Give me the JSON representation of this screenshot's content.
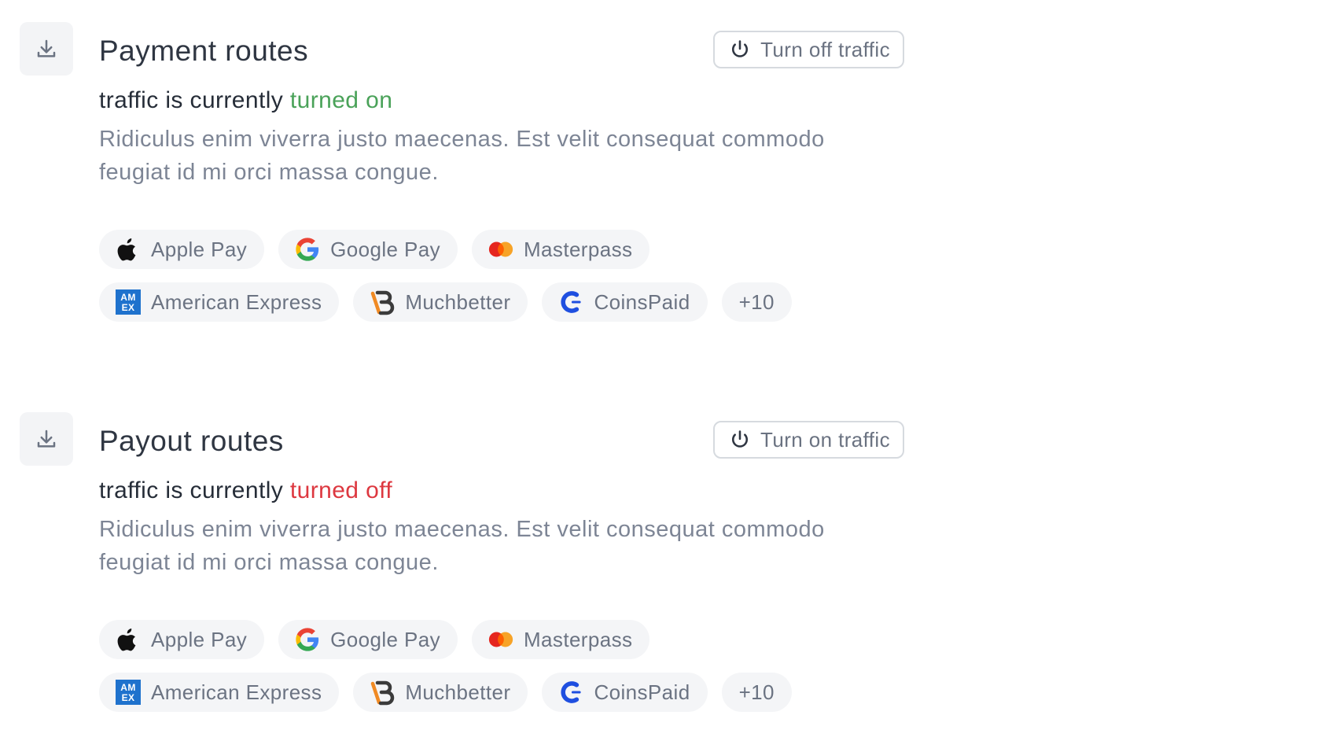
{
  "sections": [
    {
      "title": "Payment routes",
      "button_label": "Turn off traffic",
      "status_prefix": "traffic is currently",
      "status_value": "turned on",
      "description": "Ridiculus enim viverra justo maecenas. Est velit consequat commodo feugiat id mi orci massa congue.",
      "methods": [
        "Apple Pay",
        "Google Pay",
        "Masterpass",
        "American Express",
        "Muchbetter",
        "CoinsPaid"
      ],
      "more": "+10"
    },
    {
      "title": "Payout routes",
      "button_label": "Turn on traffic",
      "status_prefix": "traffic is currently",
      "status_value": "turned off",
      "description": "Ridiculus enim viverra justo maecenas. Est velit consequat commodo feugiat id mi orci massa congue.",
      "methods": [
        "Apple Pay",
        "Google Pay",
        "Masterpass",
        "American Express",
        "Muchbetter",
        "CoinsPaid"
      ],
      "more": "+10"
    }
  ],
  "colors": {
    "status_on": "#4aa259",
    "status_off": "#dd3840"
  },
  "icons": {
    "section_icon": "download-icon",
    "button_icon": "power-icon",
    "methods": [
      "apple-logo-icon",
      "google-logo-icon",
      "masterpass-logo-icon",
      "amex-logo-icon",
      "muchbetter-logo-icon",
      "coinspaid-logo-icon"
    ]
  }
}
